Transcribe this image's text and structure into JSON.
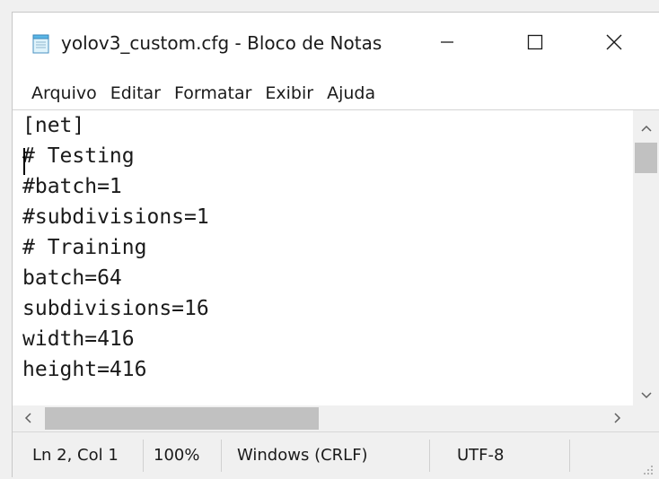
{
  "window": {
    "title": "yolov3_custom.cfg - Bloco de Notas",
    "icon": "notepad-icon"
  },
  "controls": {
    "minimize_icon": "minimize-icon",
    "maximize_icon": "maximize-icon",
    "close_icon": "close-icon"
  },
  "menu": {
    "items": [
      "Arquivo",
      "Editar",
      "Formatar",
      "Exibir",
      "Ajuda"
    ]
  },
  "editor": {
    "lines": [
      "[net]",
      "# Testing",
      "#batch=1",
      "#subdivisions=1",
      "# Training",
      "batch=64",
      "subdivisions=16",
      "width=416",
      "height=416"
    ]
  },
  "status": {
    "position": "Ln 2, Col 1",
    "zoom": "100%",
    "line_endings": "Windows (CRLF)",
    "encoding": "UTF-8"
  },
  "colors": {
    "scroll_thumb": "#c1c1c1",
    "chrome_bg": "#f0f0f0"
  }
}
